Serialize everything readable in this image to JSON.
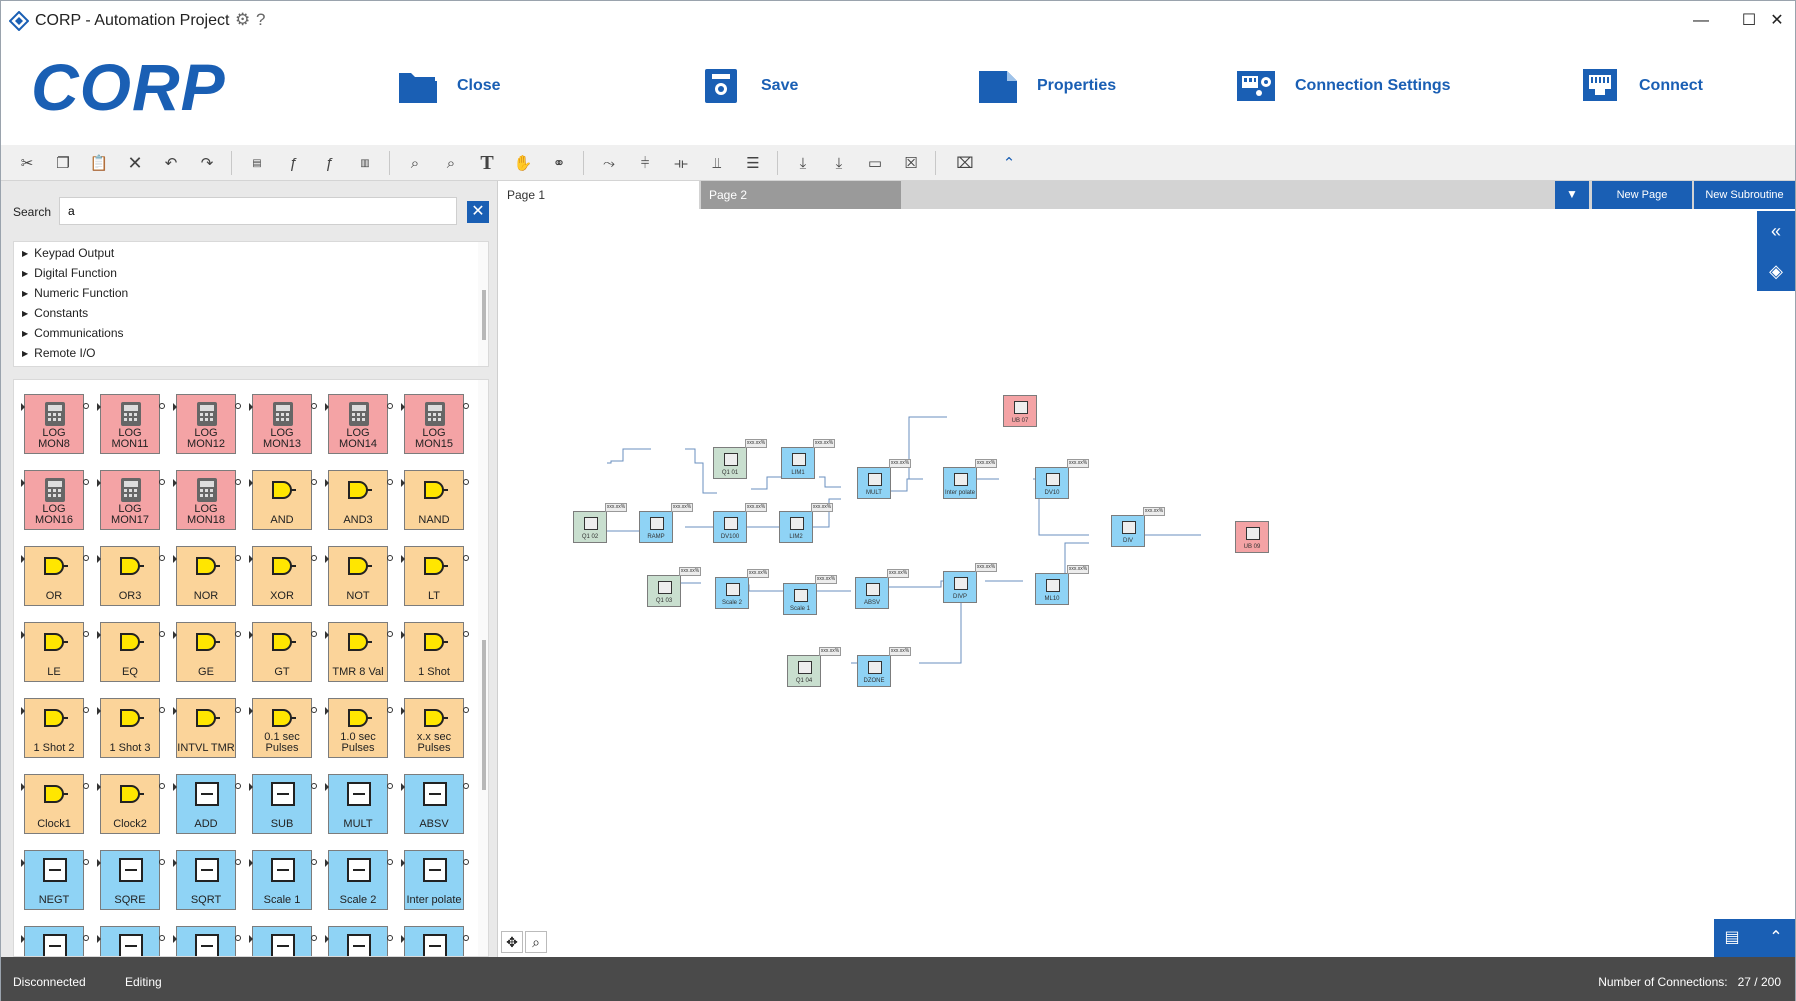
{
  "window": {
    "title": "CORP - Automation Project",
    "controls": [
      "—",
      "☐",
      "✕"
    ]
  },
  "ribbon": {
    "logo": "CORP",
    "buttons": [
      {
        "label": "Close",
        "icon": "folder-icon"
      },
      {
        "label": "Save",
        "icon": "save-icon"
      },
      {
        "label": "Properties",
        "icon": "properties-icon"
      },
      {
        "label": "Connection Settings",
        "icon": "connection-settings-icon"
      },
      {
        "label": "Connect",
        "icon": "connect-icon"
      }
    ]
  },
  "search": {
    "label": "Search",
    "value": "a"
  },
  "tree": [
    "Keypad Output",
    "Digital Function",
    "Numeric Function",
    "Constants",
    "Communications",
    "Remote I/O"
  ],
  "palette": [
    {
      "label": "LOG MON8",
      "color": "red"
    },
    {
      "label": "LOG MON11",
      "color": "red"
    },
    {
      "label": "LOG MON12",
      "color": "red"
    },
    {
      "label": "LOG MON13",
      "color": "red"
    },
    {
      "label": "LOG MON14",
      "color": "red"
    },
    {
      "label": "LOG MON15",
      "color": "red"
    },
    {
      "label": "LOG MON16",
      "color": "red"
    },
    {
      "label": "LOG MON17",
      "color": "red"
    },
    {
      "label": "LOG MON18",
      "color": "red"
    },
    {
      "label": "AND",
      "color": "tan"
    },
    {
      "label": "AND3",
      "color": "tan"
    },
    {
      "label": "NAND",
      "color": "tan"
    },
    {
      "label": "OR",
      "color": "tan"
    },
    {
      "label": "OR3",
      "color": "tan"
    },
    {
      "label": "NOR",
      "color": "tan"
    },
    {
      "label": "XOR",
      "color": "tan"
    },
    {
      "label": "NOT",
      "color": "tan"
    },
    {
      "label": "LT",
      "color": "tan"
    },
    {
      "label": "LE",
      "color": "tan"
    },
    {
      "label": "EQ",
      "color": "tan"
    },
    {
      "label": "GE",
      "color": "tan"
    },
    {
      "label": "GT",
      "color": "tan"
    },
    {
      "label": "TMR 8 Val",
      "color": "tan"
    },
    {
      "label": "1 Shot",
      "color": "tan"
    },
    {
      "label": "1 Shot 2",
      "color": "tan"
    },
    {
      "label": "1 Shot 3",
      "color": "tan"
    },
    {
      "label": "INTVL TMR",
      "color": "tan"
    },
    {
      "label": "0.1 sec Pulses",
      "color": "tan"
    },
    {
      "label": "1.0 sec Pulses",
      "color": "tan"
    },
    {
      "label": "x.x sec Pulses",
      "color": "tan"
    },
    {
      "label": "Clock1",
      "color": "tan"
    },
    {
      "label": "Clock2",
      "color": "tan"
    },
    {
      "label": "ADD",
      "color": "blue"
    },
    {
      "label": "SUB",
      "color": "blue"
    },
    {
      "label": "MULT",
      "color": "blue"
    },
    {
      "label": "ABSV",
      "color": "blue"
    },
    {
      "label": "NEGT",
      "color": "blue"
    },
    {
      "label": "SQRE",
      "color": "blue"
    },
    {
      "label": "SQRT",
      "color": "blue"
    },
    {
      "label": "Scale 1",
      "color": "blue"
    },
    {
      "label": "Scale 2",
      "color": "blue"
    },
    {
      "label": "Inter polate",
      "color": "blue"
    },
    {
      "label": "",
      "color": "blue"
    },
    {
      "label": "",
      "color": "blue"
    },
    {
      "label": "",
      "color": "blue"
    },
    {
      "label": "",
      "color": "blue"
    },
    {
      "label": "",
      "color": "blue"
    },
    {
      "label": "",
      "color": "blue"
    }
  ],
  "tabs": {
    "page1": "Page 1",
    "page2": "Page 2",
    "new_page": "New Page",
    "new_subroutine": "New Subroutine"
  },
  "diagram": {
    "tag": "xxx.xx%",
    "nodes": [
      {
        "label": "Q1 02",
        "color": "g"
      },
      {
        "label": "RAMP",
        "color": "b"
      },
      {
        "label": "DV100",
        "color": "b"
      },
      {
        "label": "LIM2",
        "color": "b"
      },
      {
        "label": "Q1 01",
        "color": "g"
      },
      {
        "label": "LIM1",
        "color": "b"
      },
      {
        "label": "MULT",
        "color": "b"
      },
      {
        "label": "Inter polate",
        "color": "b"
      },
      {
        "label": "DV10",
        "color": "b"
      },
      {
        "label": "UB 07",
        "color": "r"
      },
      {
        "label": "DIV",
        "color": "b"
      },
      {
        "label": "UB 09",
        "color": "r"
      },
      {
        "label": "Q1 03",
        "color": "g"
      },
      {
        "label": "Scale 2",
        "color": "b"
      },
      {
        "label": "Scale 1",
        "color": "b"
      },
      {
        "label": "ABSV",
        "color": "b"
      },
      {
        "label": "DIVP",
        "color": "b"
      },
      {
        "label": "ML10",
        "color": "b"
      },
      {
        "label": "Q1 04",
        "color": "g"
      },
      {
        "label": "DZONE",
        "color": "b"
      }
    ]
  },
  "status": {
    "connection": "Disconnected",
    "mode": "Editing",
    "connections_label": "Number of Connections:",
    "connections_value": "27 / 200"
  },
  "colors": {
    "accent": "#1a5fb4",
    "red_block": "#f4a3a5",
    "tan_block": "#fbd49a",
    "blue_block": "#8fd3f5",
    "green_block": "#c9dfcf"
  }
}
